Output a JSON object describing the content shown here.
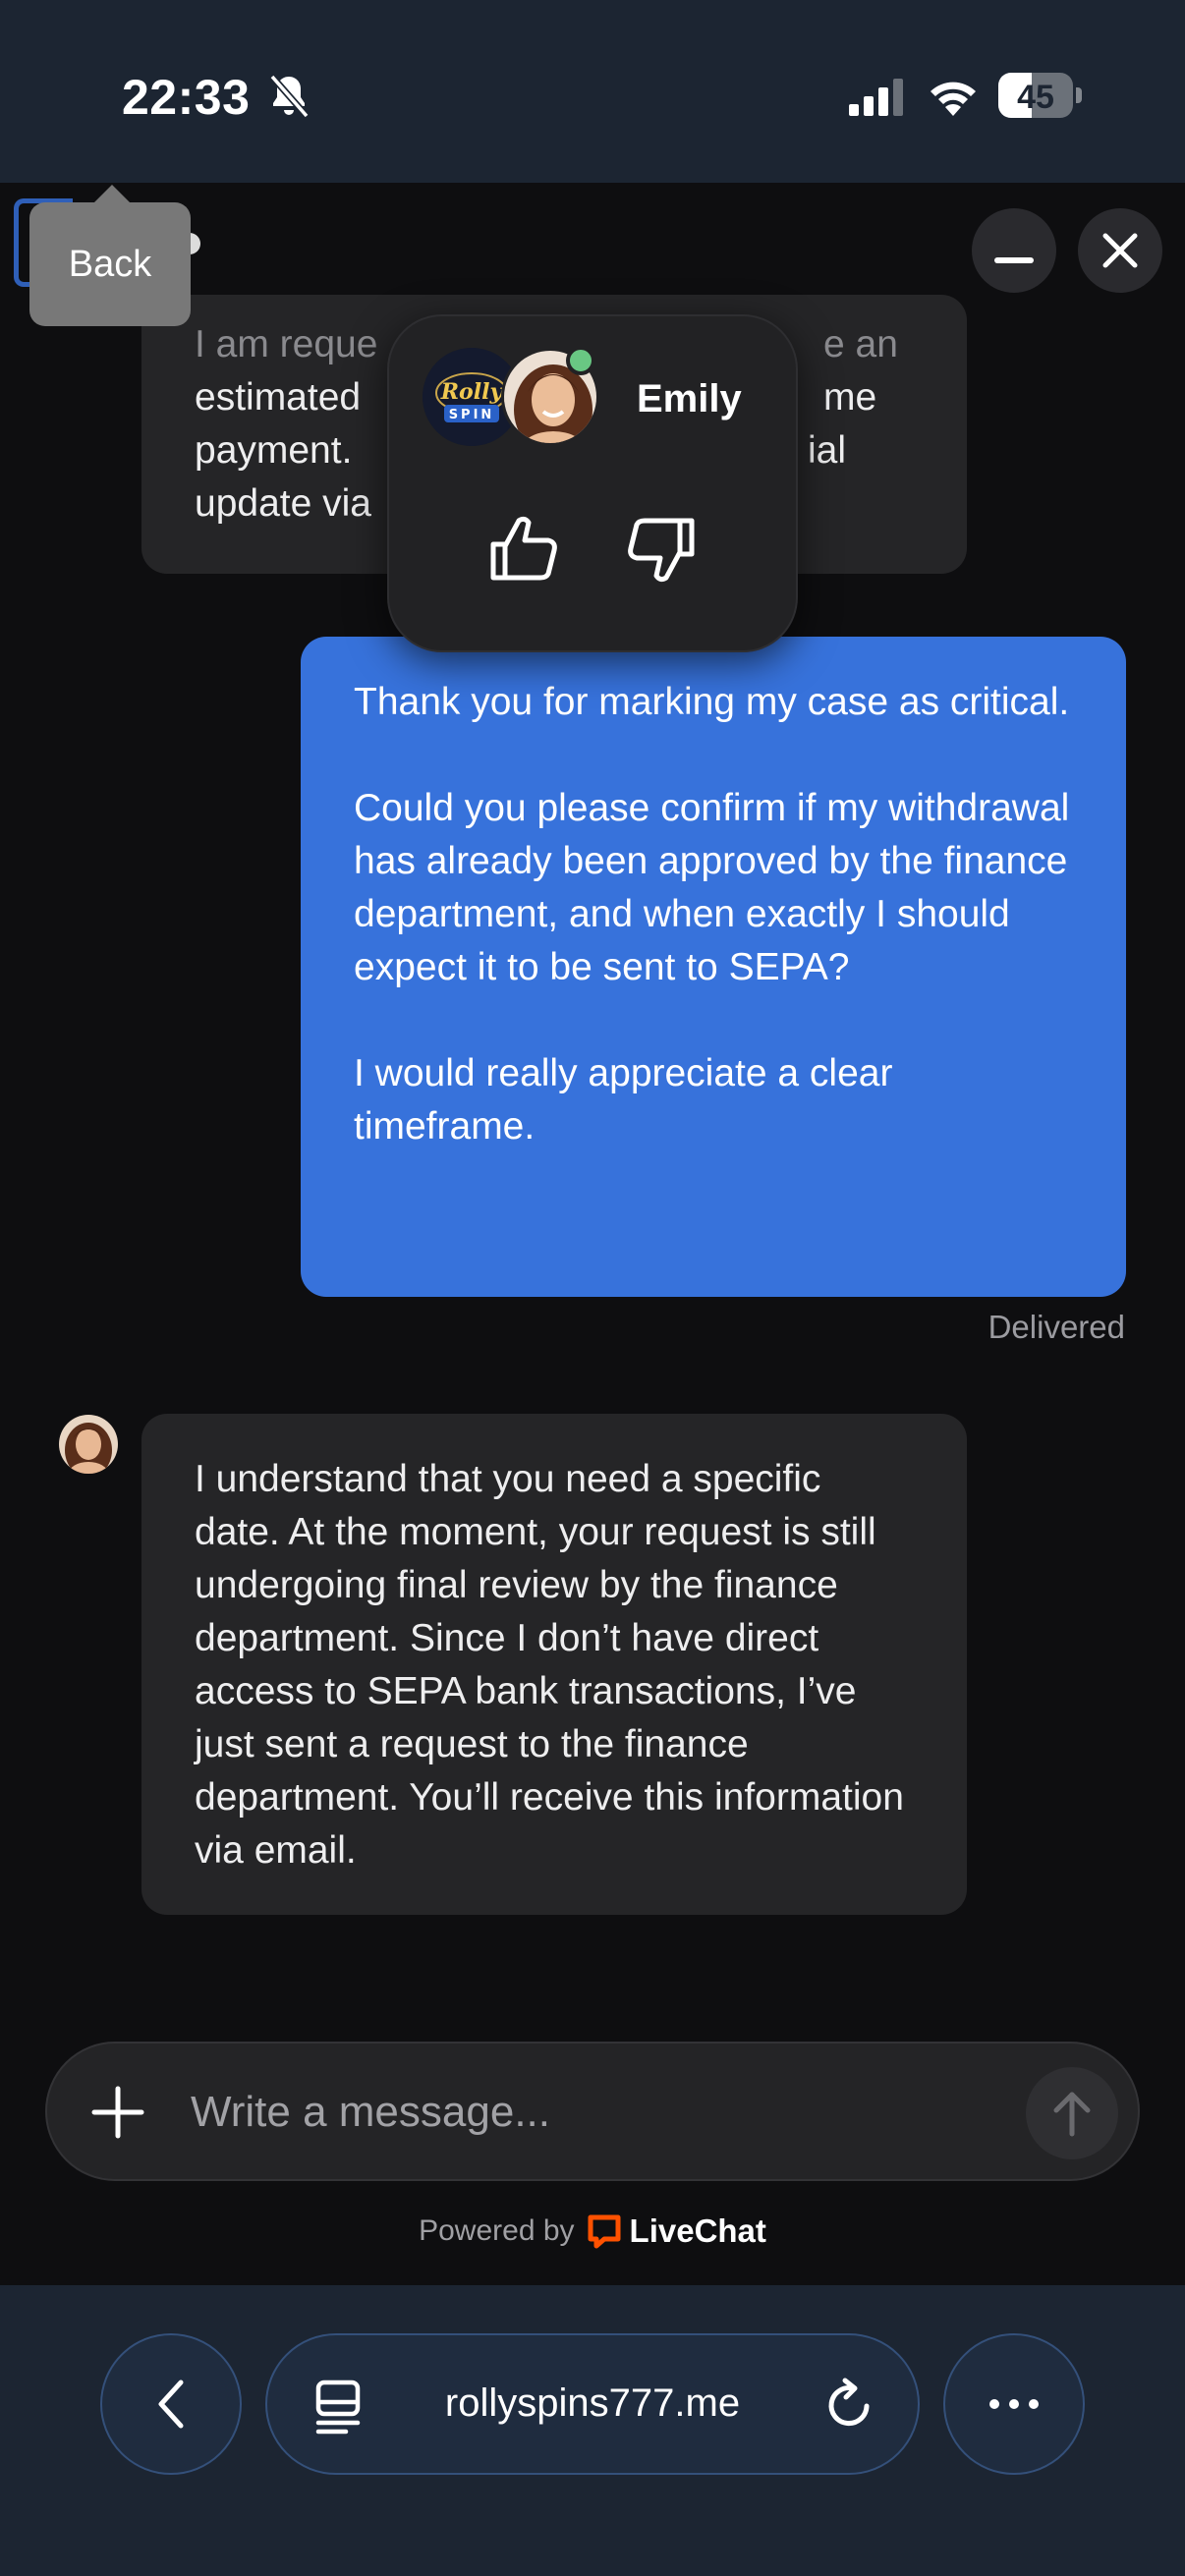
{
  "status_bar": {
    "time": "22:33",
    "battery": "45",
    "battery_level": 0.45
  },
  "header": {
    "back_tooltip": "Back"
  },
  "rating_popup": {
    "agent_name": "Emily",
    "brand_logo_text": "Rolly SPIN"
  },
  "messages": {
    "previous_agent_lines": [
      "I am reque",
      "estimated",
      "payment.",
      "update via"
    ],
    "previous_agent_right_fragments": [
      "e an",
      "me",
      "ial"
    ],
    "user_message": "Thank you for marking my case as critical.\n\nCould you please confirm if my withdrawal has already been approved by the finance department, and when exactly I should expect it to be sent to SEPA?\n\nI would really appreciate a clear timeframe.",
    "delivered_label": "Delivered",
    "agent_message": "I understand that you need a specific date. At the moment, your request is still undergoing final review by the finance department. Since I don’t have direct access to SEPA bank transactions, I’ve just sent a request to the finance department. You’ll receive this information via email."
  },
  "composer": {
    "placeholder": "Write a message...",
    "value": ""
  },
  "footer": {
    "powered_by": "Powered by",
    "brand": "LiveChat"
  },
  "browser": {
    "url": "rollyspins777.me"
  },
  "colors": {
    "user_bubble": "#3772db",
    "agent_bubble": "#252527",
    "online": "#69c783",
    "livechat_brand": "#ff5100"
  },
  "icons": [
    "bell-slash-icon",
    "signal-icon",
    "wifi-icon",
    "minimize-icon",
    "close-icon",
    "thumb-up-icon",
    "thumb-down-icon",
    "plus-icon",
    "send-arrow-icon",
    "chevron-left-icon",
    "tabs-icon",
    "reload-icon",
    "more-icon"
  ]
}
